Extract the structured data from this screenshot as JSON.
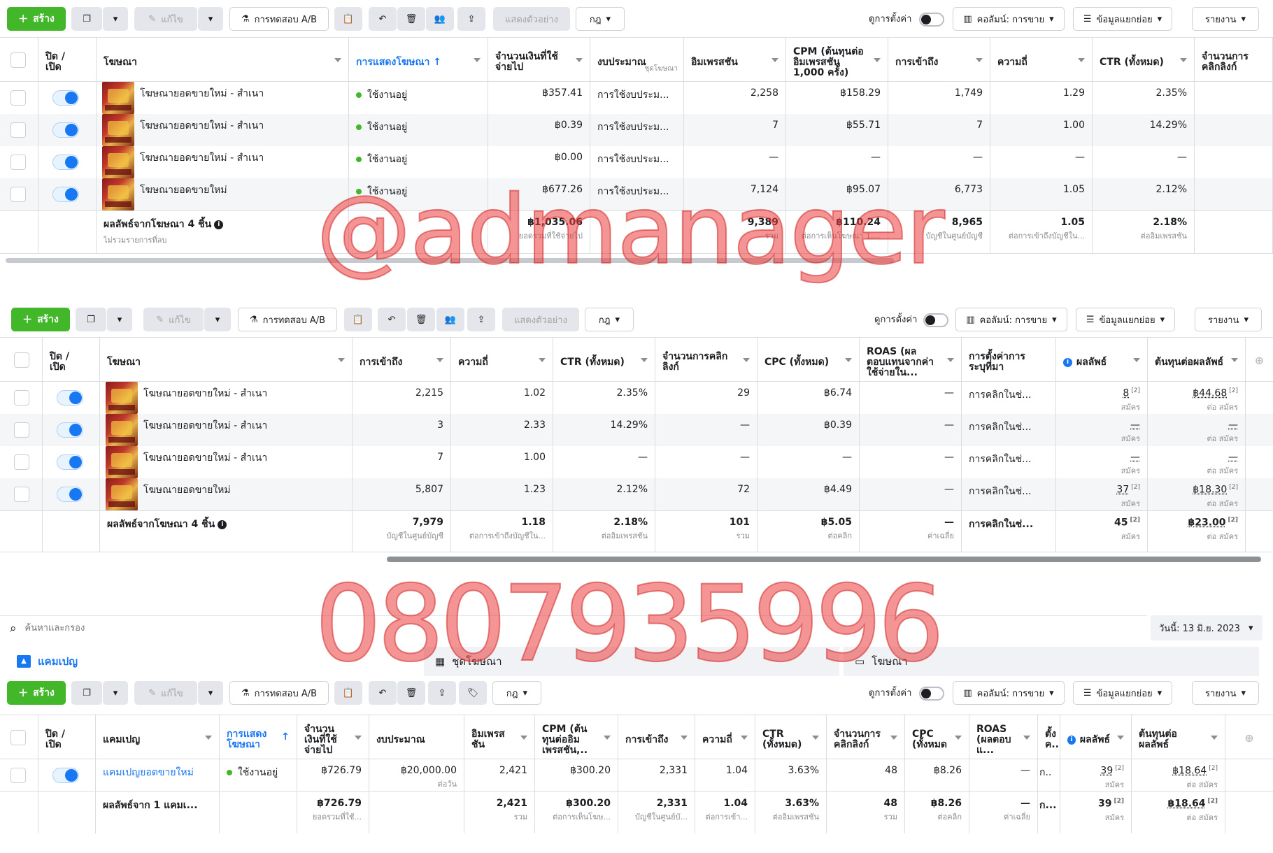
{
  "toolbar": {
    "create_label": "สร้าง",
    "edit_label": "แก้ไข",
    "ab_test_label": "การทดสอบ A/B",
    "preview_label": "แสดงตัวอย่าง",
    "rules_label": "กฎ",
    "view_settings_label": "ดูการตั้งค่า",
    "columns_label": "คอลัมน์: การขาย",
    "breakdown_label": "ข้อมูลแยกย่อย",
    "reports_label": "รายงาน"
  },
  "table1": {
    "headers": [
      "ปิด / เปิด",
      "โฆษณา",
      "การแสดงโฆษณา ↑",
      "จำนวนเงินที่ใช้จ่ายไป",
      "งบประมาณ",
      "อิมเพรสชัน",
      "CPM (ต้นทุนต่ออิมเพรสชัน 1,000 ครั้ง)",
      "การเข้าถึง",
      "ความถี่",
      "CTR (ทั้งหมด)",
      "จำนวนการคลิกลิงก์"
    ],
    "budget_sub": "ชุดโฆษณา",
    "rows": [
      {
        "name": "โฆษณายอดขายใหม่ - สำเนา",
        "status": "ใช้งานอยู่",
        "spent": "฿357.41",
        "budget": "การใช้งบประม...",
        "impressions": "2,258",
        "cpm": "฿158.29",
        "reach": "1,749",
        "frequency": "1.29",
        "ctr": "2.35%"
      },
      {
        "name": "โฆษณายอดขายใหม่ - สำเนา",
        "status": "ใช้งานอยู่",
        "spent": "฿0.39",
        "budget": "การใช้งบประม...",
        "impressions": "7",
        "cpm": "฿55.71",
        "reach": "7",
        "frequency": "1.00",
        "ctr": "14.29%"
      },
      {
        "name": "โฆษณายอดขายใหม่ - สำเนา",
        "status": "ใช้งานอยู่",
        "spent": "฿0.00",
        "budget": "การใช้งบประม...",
        "impressions": "—",
        "cpm": "—",
        "reach": "—",
        "frequency": "—",
        "ctr": "—"
      },
      {
        "name": "โฆษณายอดขายใหม่",
        "status": "ใช้งานอยู่",
        "spent": "฿677.26",
        "budget": "การใช้งบประม...",
        "impressions": "7,124",
        "cpm": "฿95.07",
        "reach": "6,773",
        "frequency": "1.05",
        "ctr": "2.12%"
      }
    ],
    "total": {
      "label": "ผลลัพธ์จากโฆษณา 4 ชิ้น",
      "sub": "ไม่รวมรายการที่ลบ",
      "spent": "฿1,035.06",
      "spent_sub": "ยอดรวมที่ใช้จ่ายไป",
      "impressions": "9,389",
      "impressions_sub": "รวม",
      "cpm": "฿110.24",
      "cpm_sub": "ต่อการเห็นโฆษณา 1,...",
      "reach": "8,965",
      "reach_sub": "บัญชีในศูนย์บัญชี",
      "frequency": "1.05",
      "frequency_sub": "ต่อการเข้าถึงบัญชีใน...",
      "ctr": "2.18%",
      "ctr_sub": "ต่ออิมเพรสชัน"
    }
  },
  "table2": {
    "headers": [
      "ปิด / เปิด",
      "โฆษณา",
      "การเข้าถึง",
      "ความถี่",
      "CTR (ทั้งหมด)",
      "จำนวนการคลิกลิงก์",
      "CPC (ทั้งหมด)",
      "ROAS (ผลตอบแทนจากค่าใช้จ่ายใน...",
      "การตั้งค่าการระบุที่มา",
      "ผลลัพธ์",
      "ต้นทุนต่อผลลัพธ์"
    ],
    "rows": [
      {
        "name": "โฆษณายอดขายใหม่ - สำเนา",
        "reach": "2,215",
        "frequency": "1.02",
        "ctr": "2.35%",
        "clicks": "29",
        "cpc": "฿6.74",
        "roas": "—",
        "attribution": "การคลิกในช่...",
        "results": "8",
        "results_sub": "สมัคร",
        "cost": "฿44.68",
        "cost_sub": "ต่อ สมัคร"
      },
      {
        "name": "โฆษณายอดขายใหม่ - สำเนา",
        "reach": "3",
        "frequency": "2.33",
        "ctr": "14.29%",
        "clicks": "—",
        "cpc": "฿0.39",
        "roas": "—",
        "attribution": "การคลิกในช่...",
        "results": "—",
        "results_sub": "สมัคร",
        "cost": "—",
        "cost_sub": "ต่อ สมัคร"
      },
      {
        "name": "โฆษณายอดขายใหม่ - สำเนา",
        "reach": "7",
        "frequency": "1.00",
        "ctr": "—",
        "clicks": "—",
        "cpc": "—",
        "roas": "—",
        "attribution": "การคลิกในช่...",
        "results": "—",
        "results_sub": "สมัคร",
        "cost": "—",
        "cost_sub": "ต่อ สมัคร"
      },
      {
        "name": "โฆษณายอดขายใหม่",
        "reach": "5,807",
        "frequency": "1.23",
        "ctr": "2.12%",
        "clicks": "72",
        "cpc": "฿4.49",
        "roas": "—",
        "attribution": "การคลิกในช่...",
        "results": "37",
        "results_sub": "สมัคร",
        "cost": "฿18.30",
        "cost_sub": "ต่อ สมัคร"
      }
    ],
    "total": {
      "label": "ผลลัพธ์จากโฆษณา 4 ชิ้น",
      "reach": "7,979",
      "reach_sub": "บัญชีในศูนย์บัญชี",
      "frequency": "1.18",
      "frequency_sub": "ต่อการเข้าถึงบัญชีใน...",
      "ctr": "2.18%",
      "ctr_sub": "ต่ออิมเพรสชัน",
      "clicks": "101",
      "clicks_sub": "รวม",
      "cpc": "฿5.05",
      "cpc_sub": "ต่อคลิก",
      "roas": "—",
      "roas_sub": "ค่าเฉลี่ย",
      "attribution": "การคลิกในช่...",
      "results": "45",
      "results_sub": "สมัคร",
      "cost": "฿23.00",
      "cost_sub": "ต่อ สมัคร"
    },
    "sup": "[2]"
  },
  "search": {
    "placeholder": "ค้นหาและกรอง",
    "date_label": "วันนี้: 13 มิ.ย. 2023"
  },
  "tabs": {
    "campaigns": "แคมเปญ",
    "adsets": "ชุดโฆษณา",
    "ads": "โฆษณา"
  },
  "table3": {
    "headers": [
      "ปิด / เปิด",
      "แคมเปญ",
      "การแสดงโฆษณา",
      "จำนวนเงินที่ใช้จ่ายไป",
      "งบประมาณ",
      "อิมเพรสชัน",
      "CPM (ต้นทุนต่ออิมเพรสชัน,..",
      "การเข้าถึง",
      "ความถี่",
      "CTR (ทั้งหมด)",
      "จำนวนการคลิกลิงก์",
      "CPC (ทั้งหมด",
      "ROAS (ผลตอบแ...",
      "ตั้งค...",
      "ผลลัพธ์",
      "ต้นทุนต่อผลลัพธ์"
    ],
    "row": {
      "name": "แคมเปญยอดขายใหม่",
      "status": "ใช้งานอยู่",
      "spent": "฿726.79",
      "budget": "฿20,000.00",
      "budget_sub": "ต่อวัน",
      "impressions": "2,421",
      "cpm": "฿300.20",
      "reach": "2,331",
      "frequency": "1.04",
      "ctr": "3.63%",
      "clicks": "48",
      "cpc": "฿8.26",
      "roas": "—",
      "attribution": "ก..",
      "results": "39",
      "results_sub": "สมัคร",
      "cost": "฿18.64",
      "cost_sub": "ต่อ สมัคร"
    },
    "total": {
      "label": "ผลลัพธ์จาก 1 แคมเ...",
      "spent": "฿726.79",
      "spent_sub": "ยอดรวมที่ใช้...",
      "impressions": "2,421",
      "impressions_sub": "รวม",
      "cpm": "฿300.20",
      "cpm_sub": "ต่อการเห็นโฆษ...",
      "reach": "2,331",
      "reach_sub": "บัญชีในศูนย์บั...",
      "frequency": "1.04",
      "frequency_sub": "ต่อการเข้า...",
      "ctr": "3.63%",
      "ctr_sub": "ต่ออิมเพรสชัน",
      "clicks": "48",
      "clicks_sub": "รวม",
      "cpc": "฿8.26",
      "cpc_sub": "ต่อคลิก",
      "roas": "—",
      "roas_sub": "ค่าเฉลี่ย",
      "attribution": "ก...",
      "results": "39",
      "results_sub": "สมัคร",
      "cost": "฿18.64",
      "cost_sub": "ต่อ สมัคร"
    }
  },
  "watermark": {
    "handle": "@admanager",
    "phone": "0807935996"
  }
}
